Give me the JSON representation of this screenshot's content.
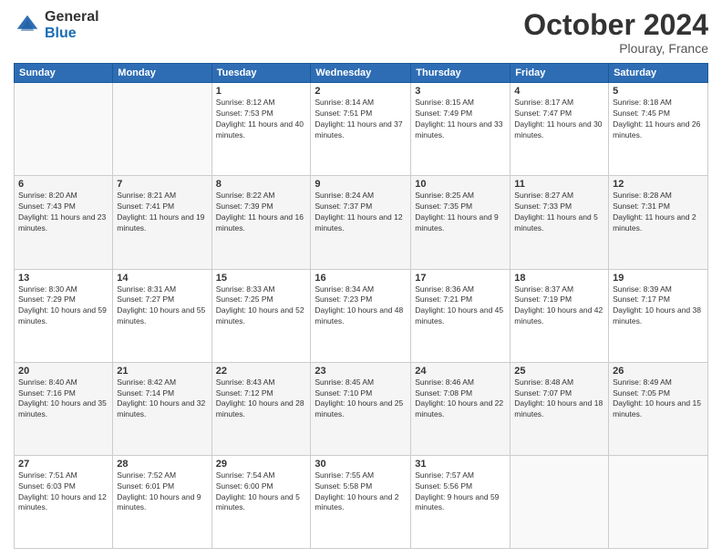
{
  "header": {
    "logo_general": "General",
    "logo_blue": "Blue",
    "month_title": "October 2024",
    "location": "Plouray, France"
  },
  "days_of_week": [
    "Sunday",
    "Monday",
    "Tuesday",
    "Wednesday",
    "Thursday",
    "Friday",
    "Saturday"
  ],
  "weeks": [
    [
      {
        "day": "",
        "info": ""
      },
      {
        "day": "",
        "info": ""
      },
      {
        "day": "1",
        "info": "Sunrise: 8:12 AM\nSunset: 7:53 PM\nDaylight: 11 hours and 40 minutes."
      },
      {
        "day": "2",
        "info": "Sunrise: 8:14 AM\nSunset: 7:51 PM\nDaylight: 11 hours and 37 minutes."
      },
      {
        "day": "3",
        "info": "Sunrise: 8:15 AM\nSunset: 7:49 PM\nDaylight: 11 hours and 33 minutes."
      },
      {
        "day": "4",
        "info": "Sunrise: 8:17 AM\nSunset: 7:47 PM\nDaylight: 11 hours and 30 minutes."
      },
      {
        "day": "5",
        "info": "Sunrise: 8:18 AM\nSunset: 7:45 PM\nDaylight: 11 hours and 26 minutes."
      }
    ],
    [
      {
        "day": "6",
        "info": "Sunrise: 8:20 AM\nSunset: 7:43 PM\nDaylight: 11 hours and 23 minutes."
      },
      {
        "day": "7",
        "info": "Sunrise: 8:21 AM\nSunset: 7:41 PM\nDaylight: 11 hours and 19 minutes."
      },
      {
        "day": "8",
        "info": "Sunrise: 8:22 AM\nSunset: 7:39 PM\nDaylight: 11 hours and 16 minutes."
      },
      {
        "day": "9",
        "info": "Sunrise: 8:24 AM\nSunset: 7:37 PM\nDaylight: 11 hours and 12 minutes."
      },
      {
        "day": "10",
        "info": "Sunrise: 8:25 AM\nSunset: 7:35 PM\nDaylight: 11 hours and 9 minutes."
      },
      {
        "day": "11",
        "info": "Sunrise: 8:27 AM\nSunset: 7:33 PM\nDaylight: 11 hours and 5 minutes."
      },
      {
        "day": "12",
        "info": "Sunrise: 8:28 AM\nSunset: 7:31 PM\nDaylight: 11 hours and 2 minutes."
      }
    ],
    [
      {
        "day": "13",
        "info": "Sunrise: 8:30 AM\nSunset: 7:29 PM\nDaylight: 10 hours and 59 minutes."
      },
      {
        "day": "14",
        "info": "Sunrise: 8:31 AM\nSunset: 7:27 PM\nDaylight: 10 hours and 55 minutes."
      },
      {
        "day": "15",
        "info": "Sunrise: 8:33 AM\nSunset: 7:25 PM\nDaylight: 10 hours and 52 minutes."
      },
      {
        "day": "16",
        "info": "Sunrise: 8:34 AM\nSunset: 7:23 PM\nDaylight: 10 hours and 48 minutes."
      },
      {
        "day": "17",
        "info": "Sunrise: 8:36 AM\nSunset: 7:21 PM\nDaylight: 10 hours and 45 minutes."
      },
      {
        "day": "18",
        "info": "Sunrise: 8:37 AM\nSunset: 7:19 PM\nDaylight: 10 hours and 42 minutes."
      },
      {
        "day": "19",
        "info": "Sunrise: 8:39 AM\nSunset: 7:17 PM\nDaylight: 10 hours and 38 minutes."
      }
    ],
    [
      {
        "day": "20",
        "info": "Sunrise: 8:40 AM\nSunset: 7:16 PM\nDaylight: 10 hours and 35 minutes."
      },
      {
        "day": "21",
        "info": "Sunrise: 8:42 AM\nSunset: 7:14 PM\nDaylight: 10 hours and 32 minutes."
      },
      {
        "day": "22",
        "info": "Sunrise: 8:43 AM\nSunset: 7:12 PM\nDaylight: 10 hours and 28 minutes."
      },
      {
        "day": "23",
        "info": "Sunrise: 8:45 AM\nSunset: 7:10 PM\nDaylight: 10 hours and 25 minutes."
      },
      {
        "day": "24",
        "info": "Sunrise: 8:46 AM\nSunset: 7:08 PM\nDaylight: 10 hours and 22 minutes."
      },
      {
        "day": "25",
        "info": "Sunrise: 8:48 AM\nSunset: 7:07 PM\nDaylight: 10 hours and 18 minutes."
      },
      {
        "day": "26",
        "info": "Sunrise: 8:49 AM\nSunset: 7:05 PM\nDaylight: 10 hours and 15 minutes."
      }
    ],
    [
      {
        "day": "27",
        "info": "Sunrise: 7:51 AM\nSunset: 6:03 PM\nDaylight: 10 hours and 12 minutes."
      },
      {
        "day": "28",
        "info": "Sunrise: 7:52 AM\nSunset: 6:01 PM\nDaylight: 10 hours and 9 minutes."
      },
      {
        "day": "29",
        "info": "Sunrise: 7:54 AM\nSunset: 6:00 PM\nDaylight: 10 hours and 5 minutes."
      },
      {
        "day": "30",
        "info": "Sunrise: 7:55 AM\nSunset: 5:58 PM\nDaylight: 10 hours and 2 minutes."
      },
      {
        "day": "31",
        "info": "Sunrise: 7:57 AM\nSunset: 5:56 PM\nDaylight: 9 hours and 59 minutes."
      },
      {
        "day": "",
        "info": ""
      },
      {
        "day": "",
        "info": ""
      }
    ]
  ]
}
